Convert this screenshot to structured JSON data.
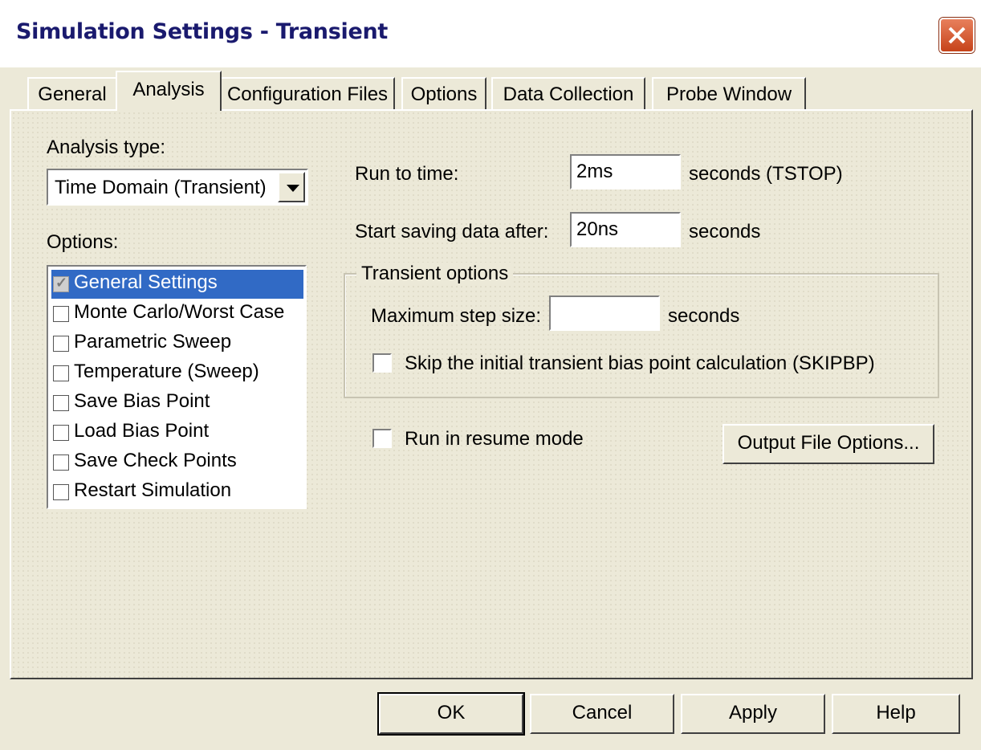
{
  "window": {
    "title": "Simulation Settings - Transient"
  },
  "tabs": [
    "General",
    "Analysis",
    "Configuration Files",
    "Options",
    "Data Collection",
    "Probe Window"
  ],
  "active_tab": "Analysis",
  "analysis_type": {
    "label": "Analysis type:",
    "selected": "Time Domain (Transient)"
  },
  "options": {
    "label": "Options:",
    "items": [
      {
        "label": "General Settings",
        "checked": true,
        "selected": true
      },
      {
        "label": "Monte Carlo/Worst Case",
        "checked": false
      },
      {
        "label": "Parametric Sweep",
        "checked": false
      },
      {
        "label": "Temperature (Sweep)",
        "checked": false
      },
      {
        "label": "Save Bias Point",
        "checked": false
      },
      {
        "label": "Load Bias Point",
        "checked": false
      },
      {
        "label": "Save Check Points",
        "checked": false
      },
      {
        "label": "Restart Simulation",
        "checked": false
      }
    ]
  },
  "run_to_time": {
    "label": "Run to time:",
    "value": "2ms",
    "unit": "seconds  (TSTOP)"
  },
  "start_saving": {
    "label": "Start saving data after:",
    "value": "20ns",
    "unit": "seconds"
  },
  "transient_options": {
    "title": "Transient options",
    "max_step": {
      "label": "Maximum step size:",
      "value": "",
      "unit": "seconds"
    },
    "skip_bias": {
      "label": "Skip the initial transient bias point calculation  (SKIPBP)",
      "checked": false
    }
  },
  "resume_mode": {
    "label": "Run in resume mode",
    "checked": false
  },
  "buttons": {
    "output_file_options": "Output File Options...",
    "ok": "OK",
    "cancel": "Cancel",
    "apply": "Apply",
    "help": "Help"
  }
}
